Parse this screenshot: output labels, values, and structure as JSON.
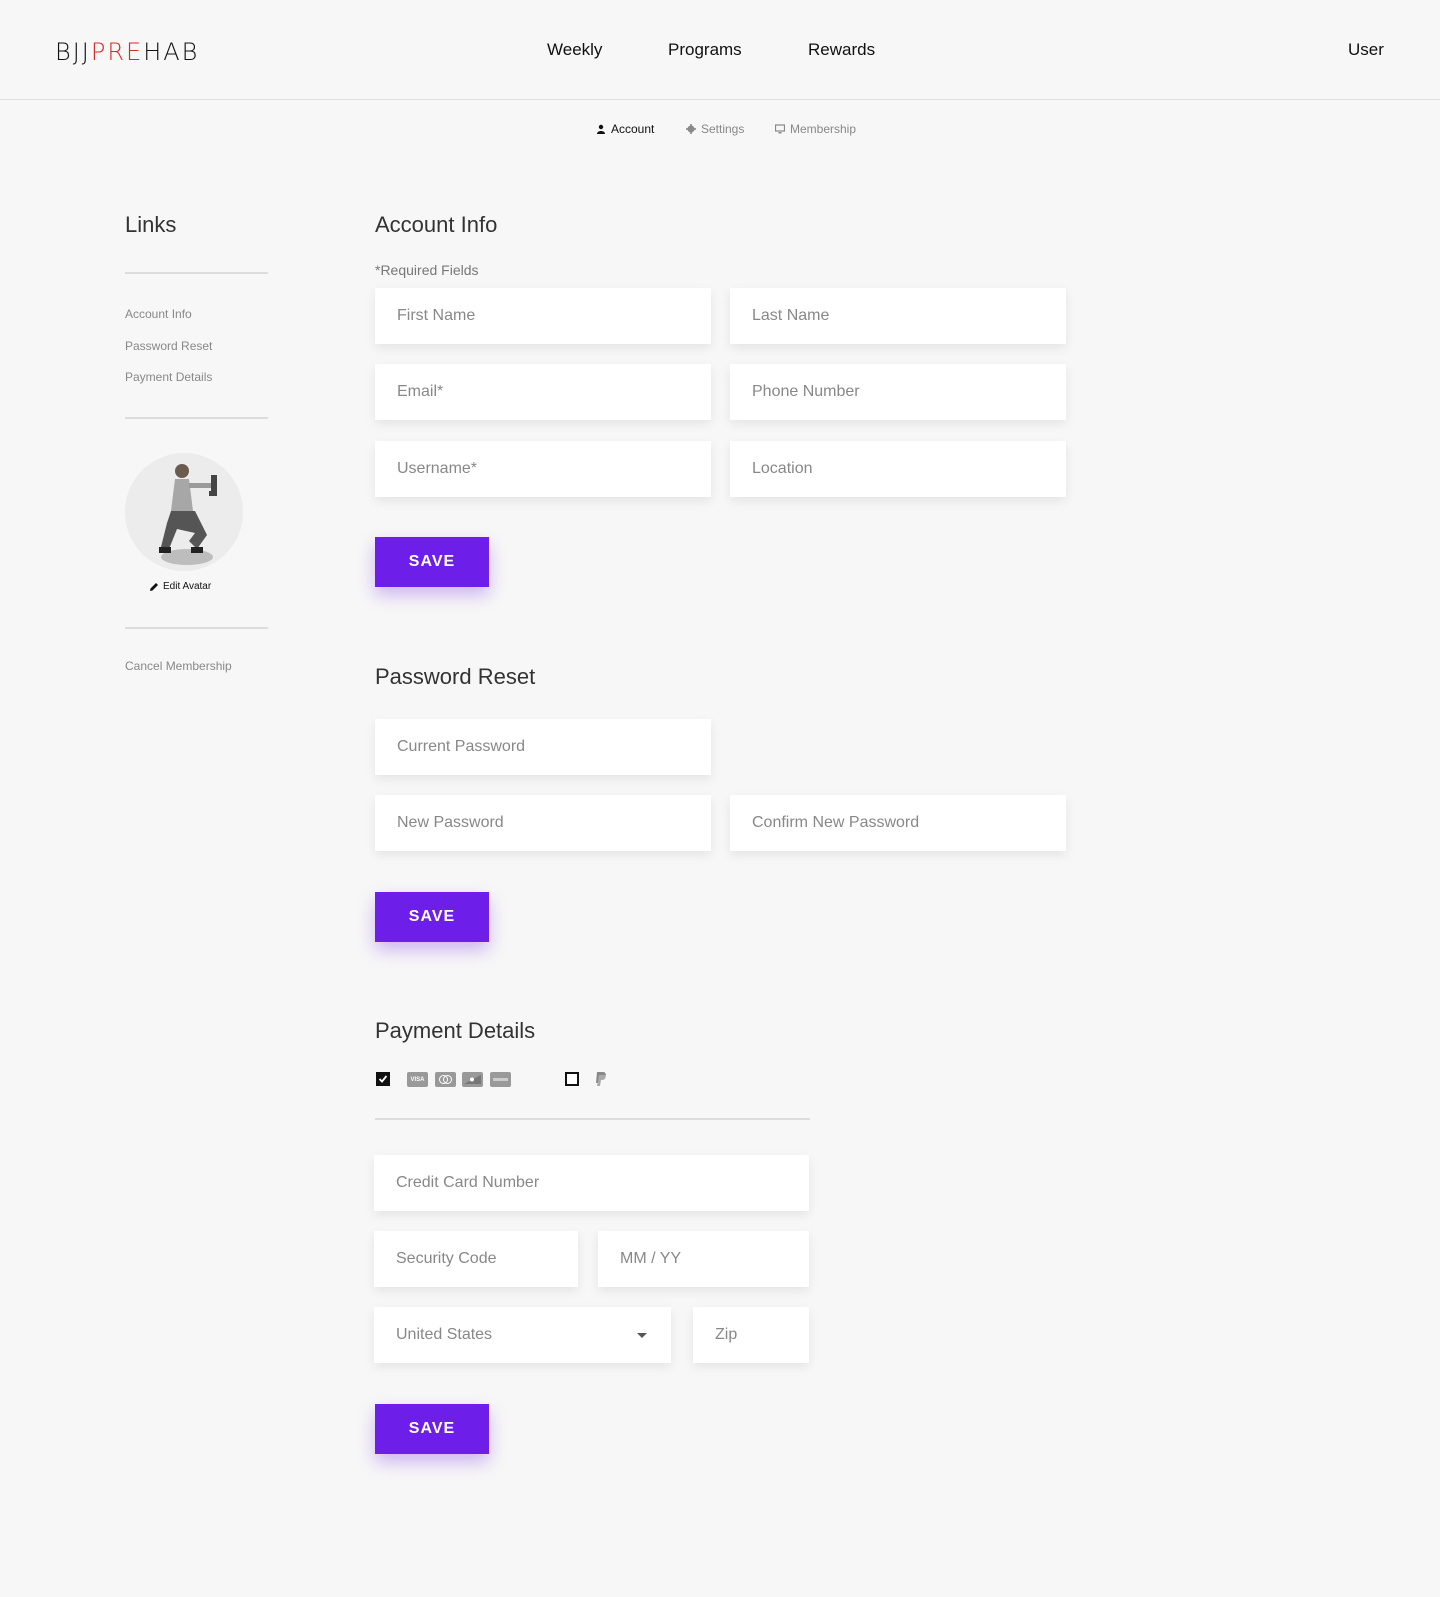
{
  "header": {
    "logo": {
      "part1": "BJJ",
      "part2": "PRE",
      "part3": "HAB"
    },
    "nav": [
      "Weekly",
      "Programs",
      "Rewards"
    ],
    "user": "User"
  },
  "subnav": {
    "account": "Account",
    "settings": "Settings",
    "membership": "Membership"
  },
  "sidebar": {
    "title": "Links",
    "links": [
      "Account Info",
      "Password Reset",
      "Payment Details"
    ],
    "edit_avatar": "Edit Avatar",
    "cancel": "Cancel Membership"
  },
  "account_info": {
    "title": "Account Info",
    "required": "*Required Fields",
    "first_name": "First Name",
    "last_name": "Last Name",
    "email": "Email*",
    "phone": "Phone Number",
    "username": "Username*",
    "location": "Location",
    "save": "SAVE"
  },
  "password_reset": {
    "title": "Password Reset",
    "current": "Current Password",
    "new": "New Password",
    "confirm": "Confirm New Password",
    "save": "SAVE"
  },
  "payment": {
    "title": "Payment Details",
    "card_checked": true,
    "paypal_checked": false,
    "card_icons": [
      "visa-icon",
      "mastercard-icon",
      "discover-icon",
      "amex-icon"
    ],
    "card_labels": [
      "VISA",
      "",
      "",
      ""
    ],
    "credit_card": "Credit Card Number",
    "security_code": "Security Code",
    "expiry": "MM / YY",
    "country": "United States",
    "zip": "Zip",
    "save": "SAVE"
  },
  "colors": {
    "accent": "#6d1fe9",
    "logo_red": "#d42a2a"
  }
}
